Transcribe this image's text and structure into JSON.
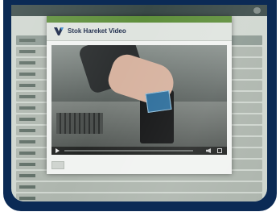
{
  "modal": {
    "title": "Stok Hareket Video"
  },
  "video": {
    "progress_percent": 0
  },
  "colors": {
    "frame": "#0b2a55",
    "modal_topbar": "#5f8f3c",
    "title_text": "#1c2a4a"
  },
  "icons": [
    "logo-icon",
    "play-icon",
    "volume-icon",
    "fullscreen-icon",
    "user-icon"
  ]
}
